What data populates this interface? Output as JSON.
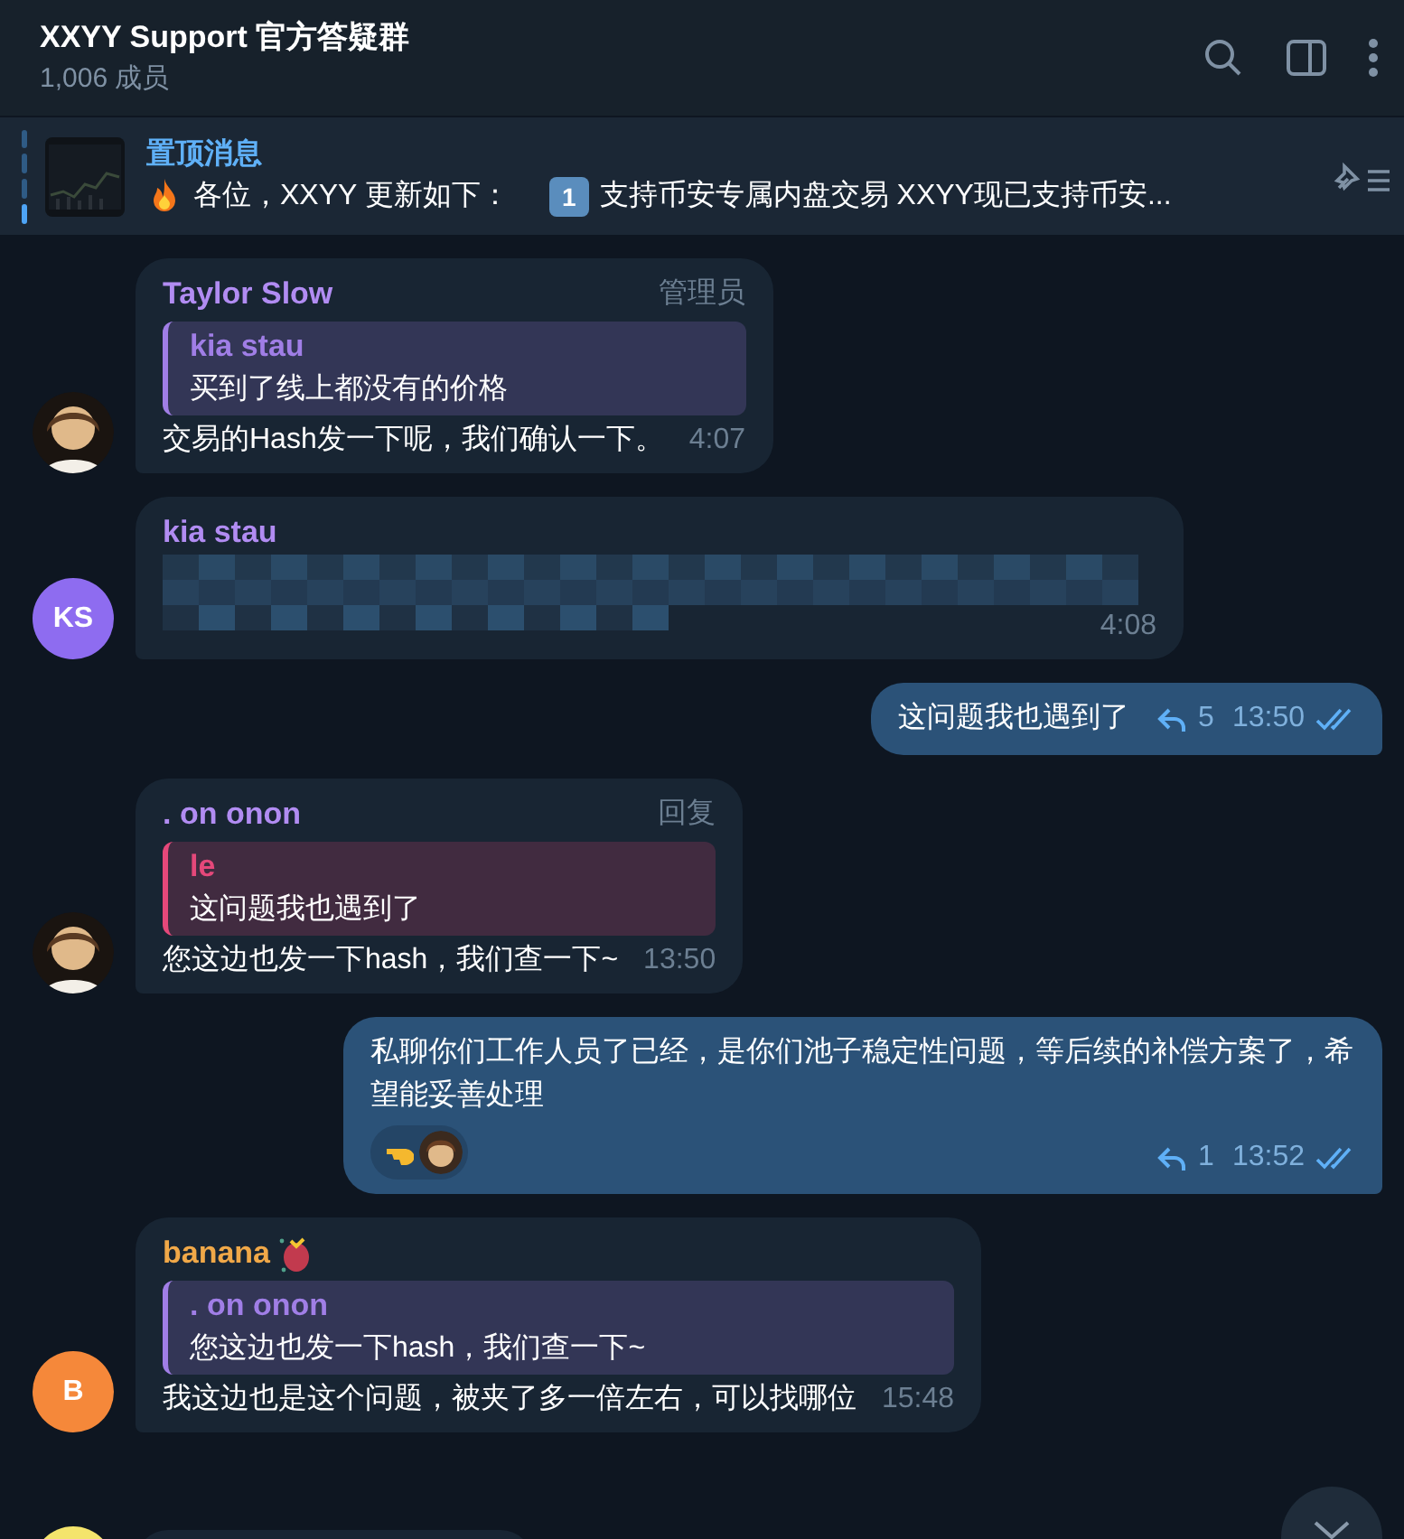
{
  "header": {
    "title": "XXYY Support 官方答疑群",
    "subtitle": "1,006 成员"
  },
  "pinned": {
    "label": "置顶消息",
    "segments": [
      {
        "kind": "fire"
      },
      {
        "kind": "text",
        "text": "各位，XXYY 更新如下："
      },
      {
        "kind": "keycap",
        "text": "1"
      },
      {
        "kind": "text",
        "text": "支持币安专属内盘交易 XXYY现已支持币安..."
      }
    ]
  },
  "messages": [
    {
      "kind": "incoming",
      "sender": "Taylor Slow",
      "color": "#b18cf2",
      "badge": "管理员",
      "quote": {
        "author": "kia stau",
        "text": "买到了线上都没有的价格",
        "color": "#a07ee6"
      },
      "text": "交易的Hash发一下呢，我们确认一下。",
      "time": "4:07"
    },
    {
      "kind": "redacted",
      "avatar": {
        "kind": "initials",
        "initials": "KS",
        "color": "#8e6cf0"
      },
      "sender": "kia stau",
      "color": "#b18cf2",
      "time": "4:08"
    },
    {
      "kind": "outgoing",
      "text": "这问题我也遇到了",
      "replies": "5",
      "time": "13:50",
      "read": true
    },
    {
      "kind": "incoming",
      "sender": ". on onon",
      "color": "#b18cf2",
      "badge": "回复",
      "quote": {
        "author": "le",
        "text": "这问题我也遇到了",
        "color": "#e5487a"
      },
      "text": "您这边也发一下hash，我们查一下~",
      "time": "13:50"
    },
    {
      "kind": "outgoing",
      "text": "私聊你们工作人员了已经，是你们池子稳定性问题，等后续的补偿方案了，希望能妥善处理",
      "reactions": [
        {
          "kind": "pointing-hand"
        }
      ],
      "replies": "1",
      "time": "13:52",
      "read": true
    },
    {
      "kind": "incoming",
      "avatar": {
        "kind": "initials",
        "initials": "B",
        "color": "#f5883a"
      },
      "sender": "banana",
      "color": "#f0a848",
      "emoji_status": true,
      "quote": {
        "author": ". on onon",
        "text": "您这边也发一下hash，我们查一下~",
        "color": "#a07ee6"
      },
      "text": "我这边也是这个问题，被夹了多一倍左右，可以找哪位",
      "time": "15:48"
    }
  ]
}
